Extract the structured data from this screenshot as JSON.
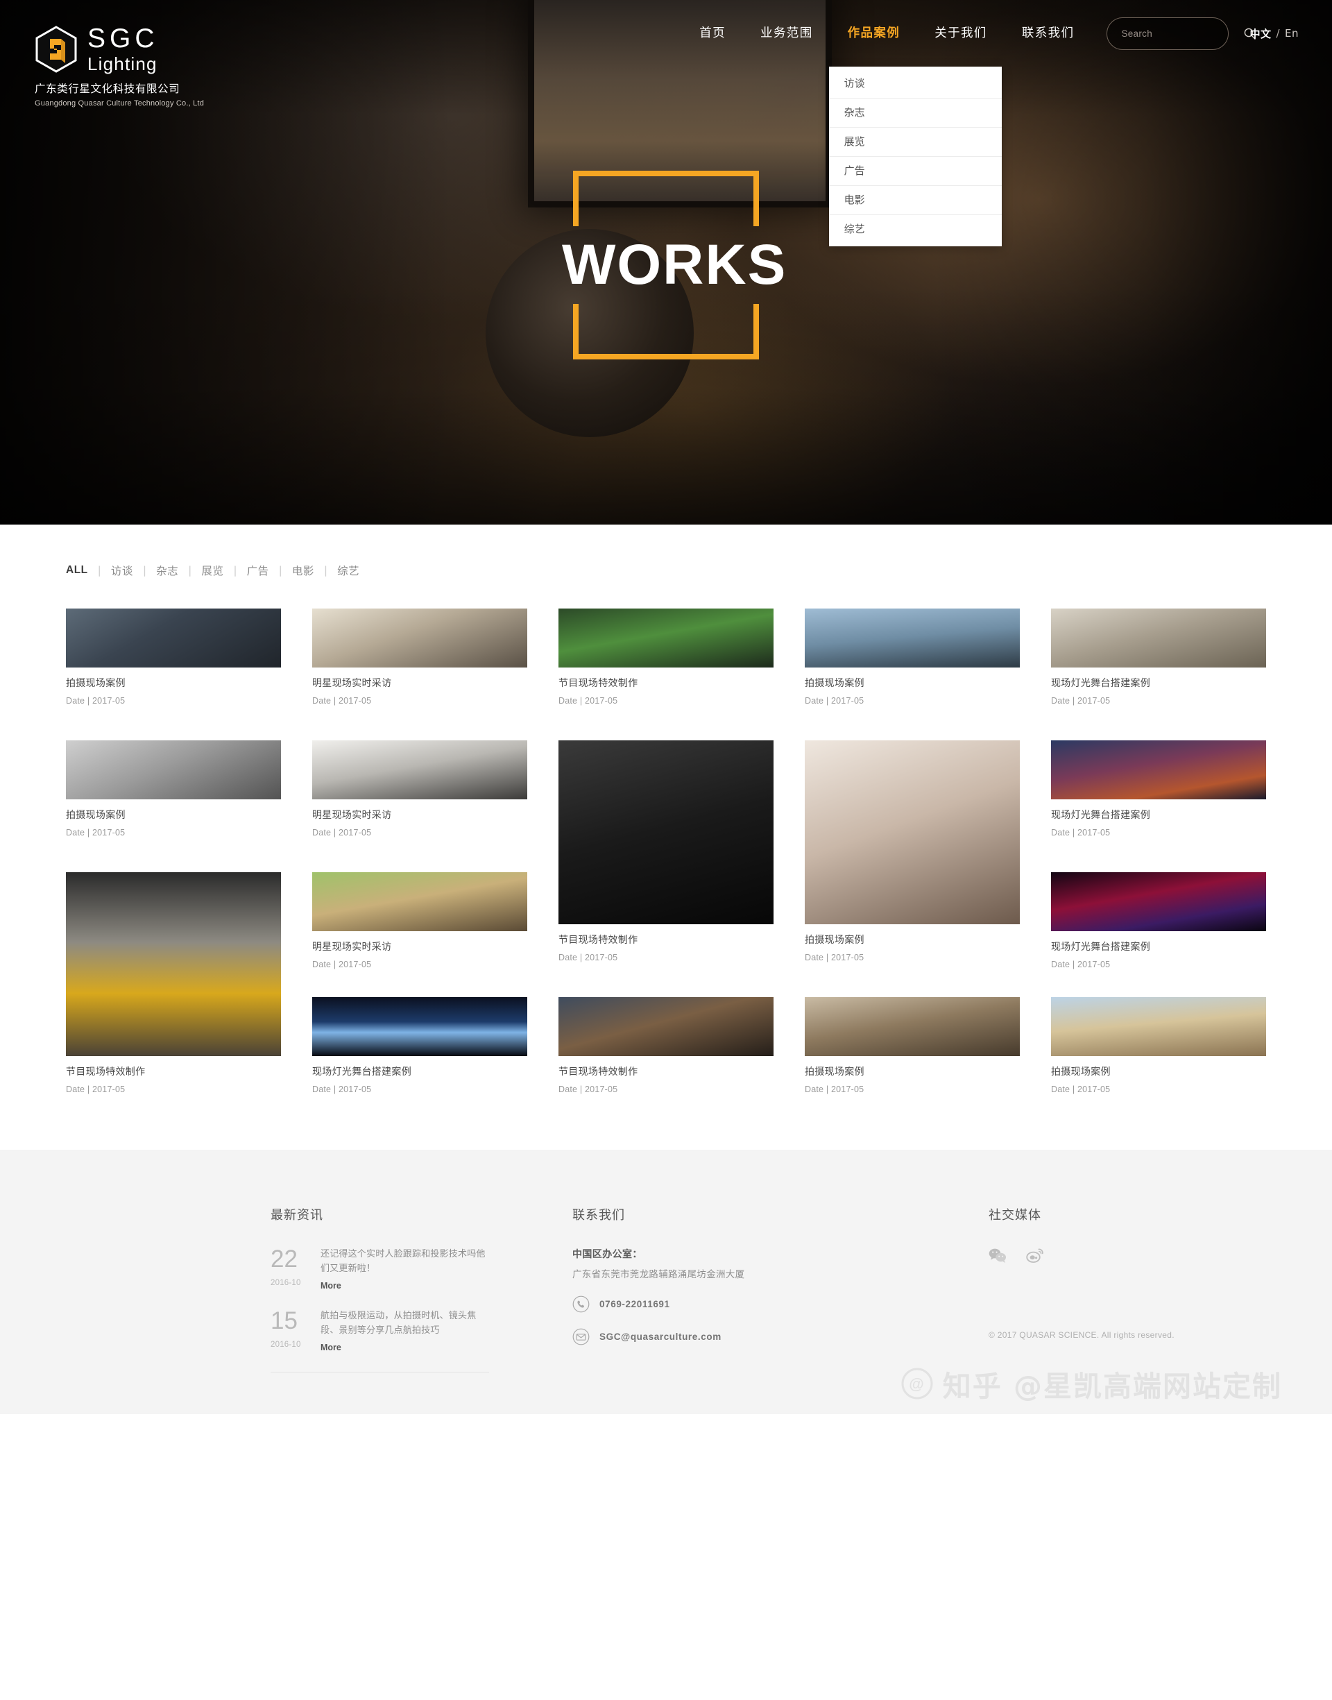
{
  "brand": {
    "logo_icon": "sgc-cube-logo",
    "name_line1": "SGC",
    "name_line2": "Lighting",
    "company_cn": "广东类行星文化科技有限公司",
    "company_en": "Guangdong Quasar Culture Technology Co., Ltd",
    "accent_color": "#f5a623"
  },
  "nav": {
    "items": [
      {
        "label": "首页",
        "active": false
      },
      {
        "label": "业务范围",
        "active": false
      },
      {
        "label": "作品案例",
        "active": true
      },
      {
        "label": "关于我们",
        "active": false
      },
      {
        "label": "联系我们",
        "active": false
      }
    ],
    "dropdown": [
      {
        "label": "访谈"
      },
      {
        "label": "杂志"
      },
      {
        "label": "展览"
      },
      {
        "label": "广告"
      },
      {
        "label": "电影"
      },
      {
        "label": "综艺"
      }
    ]
  },
  "search": {
    "placeholder": "Search",
    "value": "",
    "icon": "search-icon"
  },
  "language": {
    "current": "中文",
    "separator": "/",
    "other": "En"
  },
  "hero": {
    "title": "WORKS",
    "frame_color": "#f5a623"
  },
  "filters": {
    "items": [
      {
        "label": "ALL",
        "active": true
      },
      {
        "label": "访谈",
        "active": false
      },
      {
        "label": "杂志",
        "active": false
      },
      {
        "label": "展览",
        "active": false
      },
      {
        "label": "广告",
        "active": false
      },
      {
        "label": "电影",
        "active": false
      },
      {
        "label": "综艺",
        "active": false
      }
    ],
    "separator": "|"
  },
  "gallery": {
    "date_prefix": "Date | ",
    "items": [
      {
        "title": "拍摄现场案例",
        "date": "2017-05",
        "col": 1,
        "row_start": 1,
        "h": 14,
        "img": "studio-monitor-interview"
      },
      {
        "title": "明星现场实时采访",
        "date": "2017-05",
        "col": 2,
        "row_start": 1,
        "h": 14,
        "img": "celebrity-press-interview"
      },
      {
        "title": "节目现场特效制作",
        "date": "2017-05",
        "col": 3,
        "row_start": 1,
        "h": 14,
        "img": "green-screen-stage"
      },
      {
        "title": "拍摄现场案例",
        "date": "2017-05",
        "col": 4,
        "row_start": 1,
        "h": 14,
        "img": "outdoor-boom-mic-crew"
      },
      {
        "title": "现场灯光舞台搭建案例",
        "date": "2017-05",
        "col": 5,
        "row_start": 1,
        "h": 14,
        "img": "theatre-interior-rig"
      },
      {
        "title": "拍摄现场案例",
        "date": "2017-05",
        "col": 1,
        "row_start": 20,
        "h": 14,
        "img": "fresnel-light-array"
      },
      {
        "title": "明星现场实时采访",
        "date": "2017-05",
        "col": 2,
        "row_start": 20,
        "h": 14,
        "img": "white-room-film-set"
      },
      {
        "title": "节目现场特效制作",
        "date": "2017-05",
        "col": 3,
        "row_start": 20,
        "h": 32,
        "img": "bw-cameraman-rig"
      },
      {
        "title": "拍摄现场案例",
        "date": "2017-05",
        "col": 4,
        "row_start": 20,
        "h": 32,
        "img": "photographers-reviewing-shots"
      },
      {
        "title": "现场灯光舞台搭建案例",
        "date": "2017-05",
        "col": 5,
        "row_start": 20,
        "h": 14,
        "img": "night-city-lights"
      },
      {
        "title": "节目现场特效制作",
        "date": "2017-05",
        "col": 1,
        "row_start": 39,
        "h": 32,
        "img": "yellow-car-studio-softbox"
      },
      {
        "title": "明星现场实时采访",
        "date": "2017-05",
        "col": 2,
        "row_start": 39,
        "h": 14,
        "img": "photographer-cows-field"
      },
      {
        "title": "节目现场特效制作",
        "date": "2017-05",
        "col": 3,
        "row_start": 57,
        "h": 14,
        "img": "street-set-blue-truck"
      },
      {
        "title": "拍摄现场案例",
        "date": "2017-05",
        "col": 4,
        "row_start": 57,
        "h": 14,
        "img": "piano-service-street-scene"
      },
      {
        "title": "现场灯光舞台搭建案例",
        "date": "2017-05",
        "col": 5,
        "row_start": 39,
        "h": 14,
        "img": "red-stage-dancers"
      },
      {
        "title": "现场灯光舞台搭建案例",
        "date": "2017-05",
        "col": 2,
        "row_start": 57,
        "h": 14,
        "img": "night-searchlight-beam"
      },
      {
        "title": "拍摄现场案例",
        "date": "2017-05",
        "col": 5,
        "row_start": 57,
        "h": 14,
        "img": "camel-rider-pyramids"
      }
    ]
  },
  "footer": {
    "news": {
      "title": "最新资讯",
      "items": [
        {
          "day": "22",
          "ym": "2016-10",
          "text": "还记得这个实时人脸跟踪和投影技术吗他们又更新啦！",
          "more": "More"
        },
        {
          "day": "15",
          "ym": "2016-10",
          "text": "航拍与极限运动，从拍摄时机、镜头焦段、景别等分享几点航拍技巧",
          "more": "More"
        }
      ]
    },
    "contact": {
      "title": "联系我们",
      "office_label": "中国区办公室：",
      "address": "广东省东莞市莞龙路辅路涌尾坊金洲大厦",
      "phone_icon": "phone-icon",
      "phone": "0769-22011691",
      "email_icon": "mail-icon",
      "email": "SGC@quasarculture.com"
    },
    "social": {
      "title": "社交媒体",
      "items": [
        {
          "name": "wechat-icon"
        },
        {
          "name": "weibo-icon"
        }
      ]
    },
    "copyright": "© 2017 QUASAR SCIENCE. All rights reserved."
  },
  "watermark": {
    "text": "知乎 @星凯高端网站定制"
  }
}
